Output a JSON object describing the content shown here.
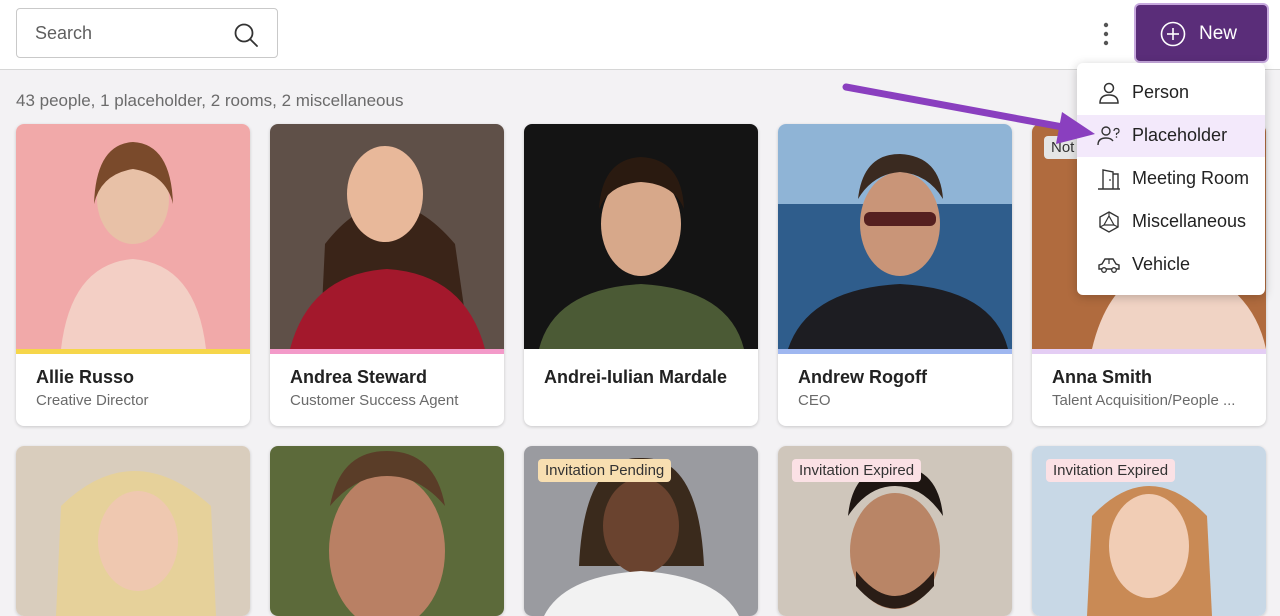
{
  "search": {
    "placeholder": "Search"
  },
  "toolbar": {
    "new_label": "New"
  },
  "summary": "43 people, 1 placeholder, 2 rooms, 2 miscellaneous",
  "new_menu": {
    "items": [
      {
        "label": "Person",
        "icon": "person-icon"
      },
      {
        "label": "Placeholder",
        "icon": "placeholder-person-icon"
      },
      {
        "label": "Meeting Room",
        "icon": "meeting-room-icon"
      },
      {
        "label": "Miscellaneous",
        "icon": "miscellaneous-icon"
      },
      {
        "label": "Vehicle",
        "icon": "vehicle-icon"
      }
    ]
  },
  "people": [
    {
      "name": "Allie Russo",
      "role": "Creative Director",
      "stripe": "#f6d64a",
      "bg": "#f1a9a9"
    },
    {
      "name": "Andrea Steward",
      "role": "Customer Success Agent",
      "stripe": "#f39ac9",
      "bg": "#6d5a4f"
    },
    {
      "name": "Andrei-Iulian Mardale",
      "role": "",
      "stripe": "#ffffff",
      "bg": "#1b1b1b"
    },
    {
      "name": "Andrew Rogoff",
      "role": "CEO",
      "stripe": "#9fb7f0",
      "bg": "#5d8fbe"
    },
    {
      "name": "Anna Smith",
      "role": "Talent Acquisition/People ...",
      "stripe": "#e4cdf4",
      "bg": "#b06b3e",
      "badge": "Not"
    }
  ],
  "people_row2": [
    {
      "badge": "",
      "bg": "#d9cdbd"
    },
    {
      "badge": "",
      "bg": "#5c6a3a"
    },
    {
      "badge": "Invitation Pending",
      "bg": "#9a9ba0"
    },
    {
      "badge": "Invitation Expired",
      "bg": "#cfc6bb"
    },
    {
      "badge": "Invitation Expired",
      "bg": "#c8d8e6"
    }
  ],
  "colors": {
    "accent": "#5a2d79",
    "arrow": "#8a3fbf"
  }
}
